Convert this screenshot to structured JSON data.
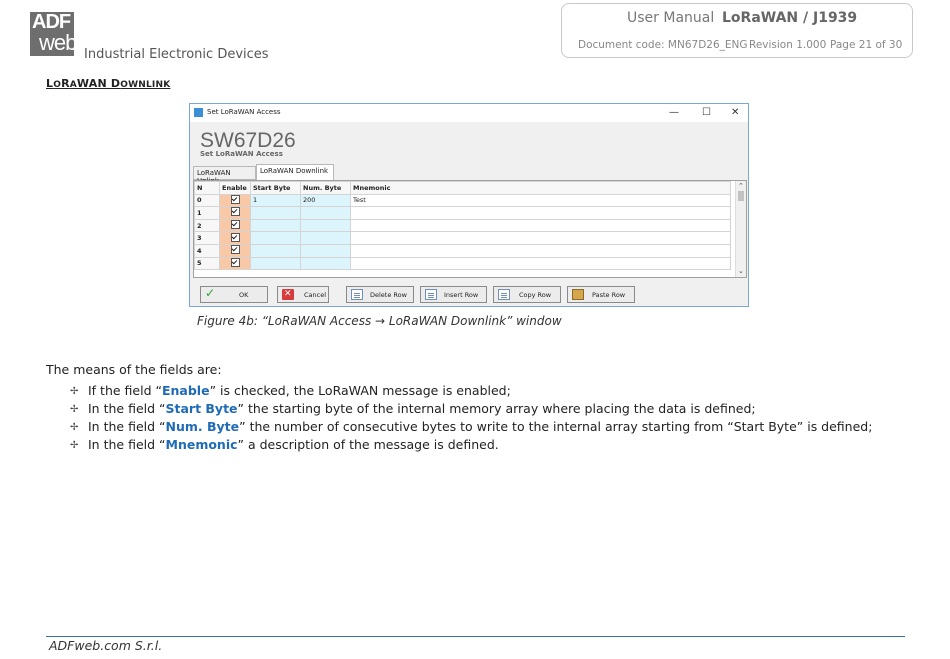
{
  "header": {
    "logo_top": "ADF",
    "logo_bottom": "web",
    "company": "Industrial Electronic Devices",
    "manual_label": "User Manual",
    "product": "LoRaWAN / J1939",
    "document_code": "Document code: MN67D26_ENG",
    "revision": "Revision 1.000",
    "page": "Page 21 of 30"
  },
  "section": {
    "title_first_cap": "L",
    "title_first_rest": "O",
    "title_mid_cap": "R",
    "title_mid_rest": "A",
    "title_wan": "WAN ",
    "title_second_cap": "D",
    "title_second_rest": "OWNLINK"
  },
  "dialog": {
    "window_title": "Set LoRaWAN Access",
    "min_glyph": "—",
    "max_glyph": "☐",
    "close_glyph": "✕",
    "app_title": "SW67D26",
    "subtitle": "Set LoRaWAN Access",
    "tabs": [
      {
        "label": "LoRaWAN Uplink",
        "active": false
      },
      {
        "label": "LoRaWAN Downlink",
        "active": true
      }
    ],
    "columns": [
      "N",
      "Enable",
      "Start Byte",
      "Num. Byte",
      "Mnemonic"
    ],
    "rows": [
      {
        "n": "0",
        "enabled": true,
        "start_byte": "1",
        "num_byte": "200",
        "mnemonic": "Test"
      },
      {
        "n": "1",
        "enabled": true,
        "start_byte": "",
        "num_byte": "",
        "mnemonic": ""
      },
      {
        "n": "2",
        "enabled": true,
        "start_byte": "",
        "num_byte": "",
        "mnemonic": ""
      },
      {
        "n": "3",
        "enabled": true,
        "start_byte": "",
        "num_byte": "",
        "mnemonic": ""
      },
      {
        "n": "4",
        "enabled": true,
        "start_byte": "",
        "num_byte": "",
        "mnemonic": ""
      },
      {
        "n": "5",
        "enabled": true,
        "start_byte": "",
        "num_byte": "",
        "mnemonic": ""
      }
    ],
    "scroll_up": "⌃",
    "scroll_down": "⌄",
    "buttons": {
      "ok": "OK",
      "cancel": "Cancel",
      "delete_row": "Delete Row",
      "insert_row": "Insert Row",
      "copy_row": "Copy Row",
      "paste_row": "Paste Row"
    }
  },
  "caption": "Figure 4b: “LoRaWAN Access → LoRaWAN Downlink” window",
  "intro": "The means of the fields are:",
  "bullet_glyph": "✢",
  "fields": [
    {
      "pre": "If the field “",
      "name": "Enable",
      "post": "” is checked, the LoRaWAN message is enabled;"
    },
    {
      "pre": "In the field “",
      "name": "Start Byte",
      "post": "” the starting byte of the internal memory array where placing the data is defined;"
    },
    {
      "pre": "In the field “",
      "name": "Num. Byte",
      "post": "” the number of consecutive bytes to write to the internal array starting from “Start Byte” is defined;"
    },
    {
      "pre": "In the field “",
      "name": "Mnemonic",
      "post": "” a description of the message is defined."
    }
  ],
  "footer": "ADFweb.com S.r.l."
}
